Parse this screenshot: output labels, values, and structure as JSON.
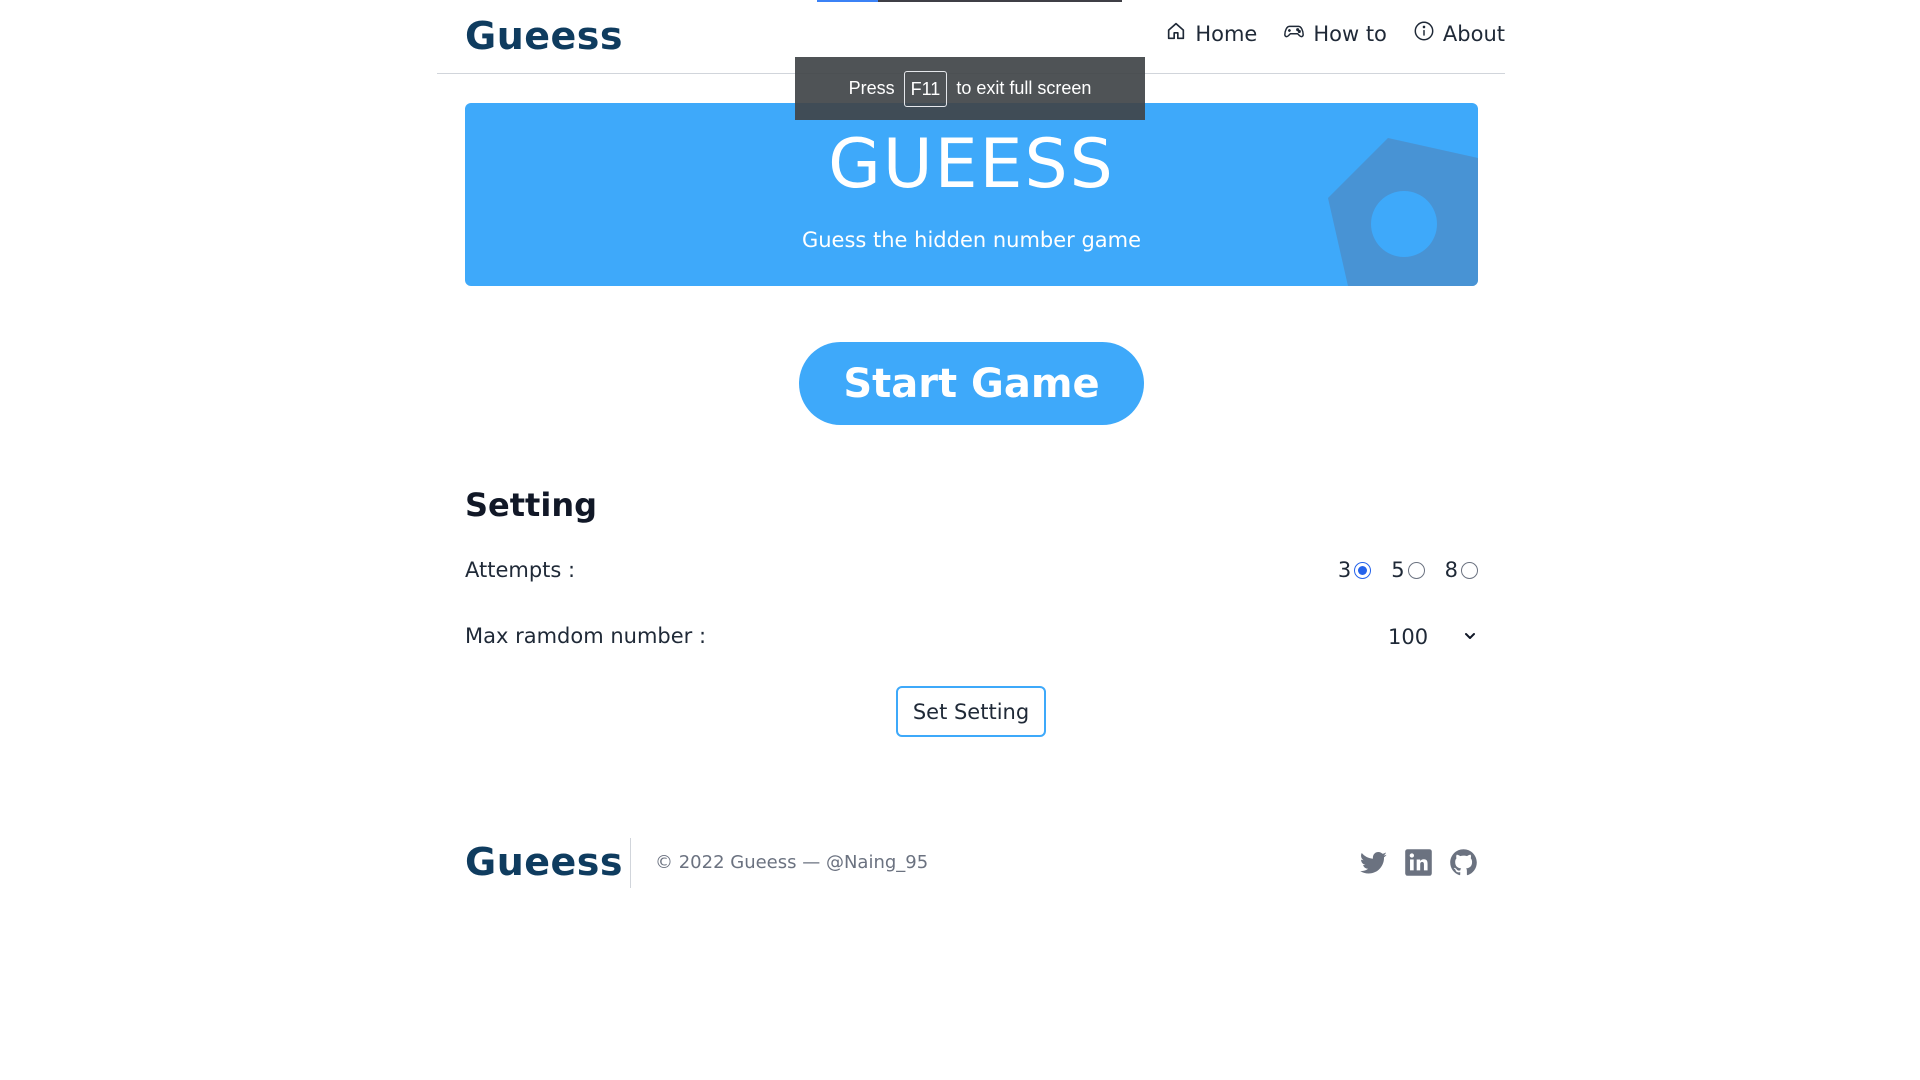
{
  "header": {
    "brand": "Gueess",
    "nav": [
      {
        "label": "Home",
        "icon": "home-icon"
      },
      {
        "label": "How to",
        "icon": "gamepad-icon"
      },
      {
        "label": "About",
        "icon": "info-icon"
      }
    ]
  },
  "fullscreen_toast": {
    "prefix": "Press",
    "key": "F11",
    "suffix": "to exit full screen"
  },
  "hero": {
    "title": "GUEESS",
    "subtitle": "Guess the hidden number game",
    "background_color": "#3ea9fa"
  },
  "start_button": {
    "label": "Start Game"
  },
  "settings": {
    "title": "Setting",
    "attempts_label": "Attempts :",
    "attempts_options": [
      "3",
      "5",
      "8"
    ],
    "attempts_selected": "3",
    "max_label": "Max ramdom number :",
    "max_selected": "100",
    "set_button_label": "Set Setting"
  },
  "footer": {
    "brand": "Gueess",
    "copyright": "© 2022 Gueess — @Naing_95",
    "socials": [
      "twitter-icon",
      "linkedin-icon",
      "github-icon"
    ]
  },
  "colors": {
    "accent": "#3ea9fa",
    "brand_text": "#0f3c5f",
    "radio_checked": "#2563eb"
  }
}
